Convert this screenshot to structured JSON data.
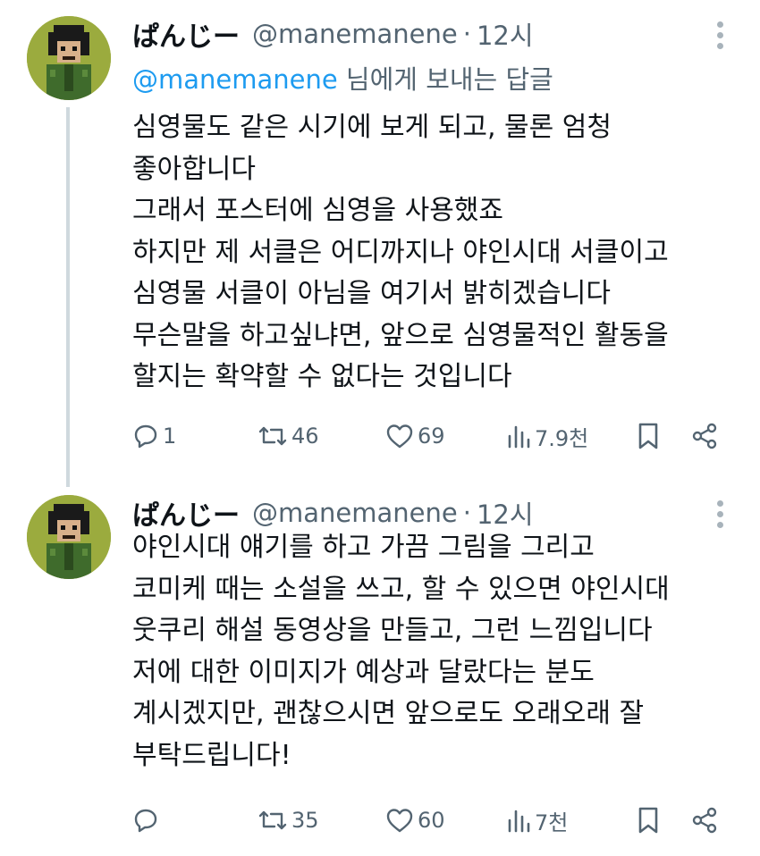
{
  "tweets": [
    {
      "author": {
        "name": "ぱんじー",
        "handle": "@manemanene",
        "time": "12시"
      },
      "reply_to": {
        "mention": "@manemanene",
        "suffix": " 님에게 보내는 답글"
      },
      "lines": [
        "심영물도 같은 시기에 보게 되고, 물론 엄청",
        "좋아합니다",
        "그래서 포스터에 심영을 사용했죠",
        "하지만 제 서클은 어디까지나 야인시대 서클이고",
        "심영물 서클이 아님을 여기서 밝히겠습니다",
        "무슨말을 하고싶냐면, 앞으로 심영물적인 활동을",
        "할지는 확약할 수 없다는 것입니다"
      ],
      "stats": {
        "replies": "1",
        "retweets": "46",
        "likes": "69",
        "views": "7.9천"
      }
    },
    {
      "author": {
        "name": "ぱんじー",
        "handle": "@manemanene",
        "time": "12시"
      },
      "lines": [
        "야인시대 얘기를 하고 가끔 그림을 그리고",
        "코미케 때는 소설을 쓰고, 할 수 있으면 야인시대",
        "웃쿠리 해설 동영상을 만들고, 그런 느낌입니다",
        "저에 대한 이미지가 예상과 달랐다는 분도",
        "계시겠지만, 괜찮으시면 앞으로도 오래오래 잘",
        "부탁드립니다!"
      ],
      "stats": {
        "replies": "",
        "retweets": "35",
        "likes": "60",
        "views": "7천"
      }
    }
  ],
  "icons": {
    "reply": "reply-icon",
    "retweet": "retweet-icon",
    "like": "heart-icon",
    "views": "views-icon",
    "bookmark": "bookmark-icon",
    "share": "share-icon",
    "more": "more-icon"
  },
  "colors": {
    "text": "#0f1419",
    "muted": "#536471",
    "link": "#1d9bf0",
    "thread_line": "#cfd9de",
    "avatar_bg": "#9bab3e"
  }
}
